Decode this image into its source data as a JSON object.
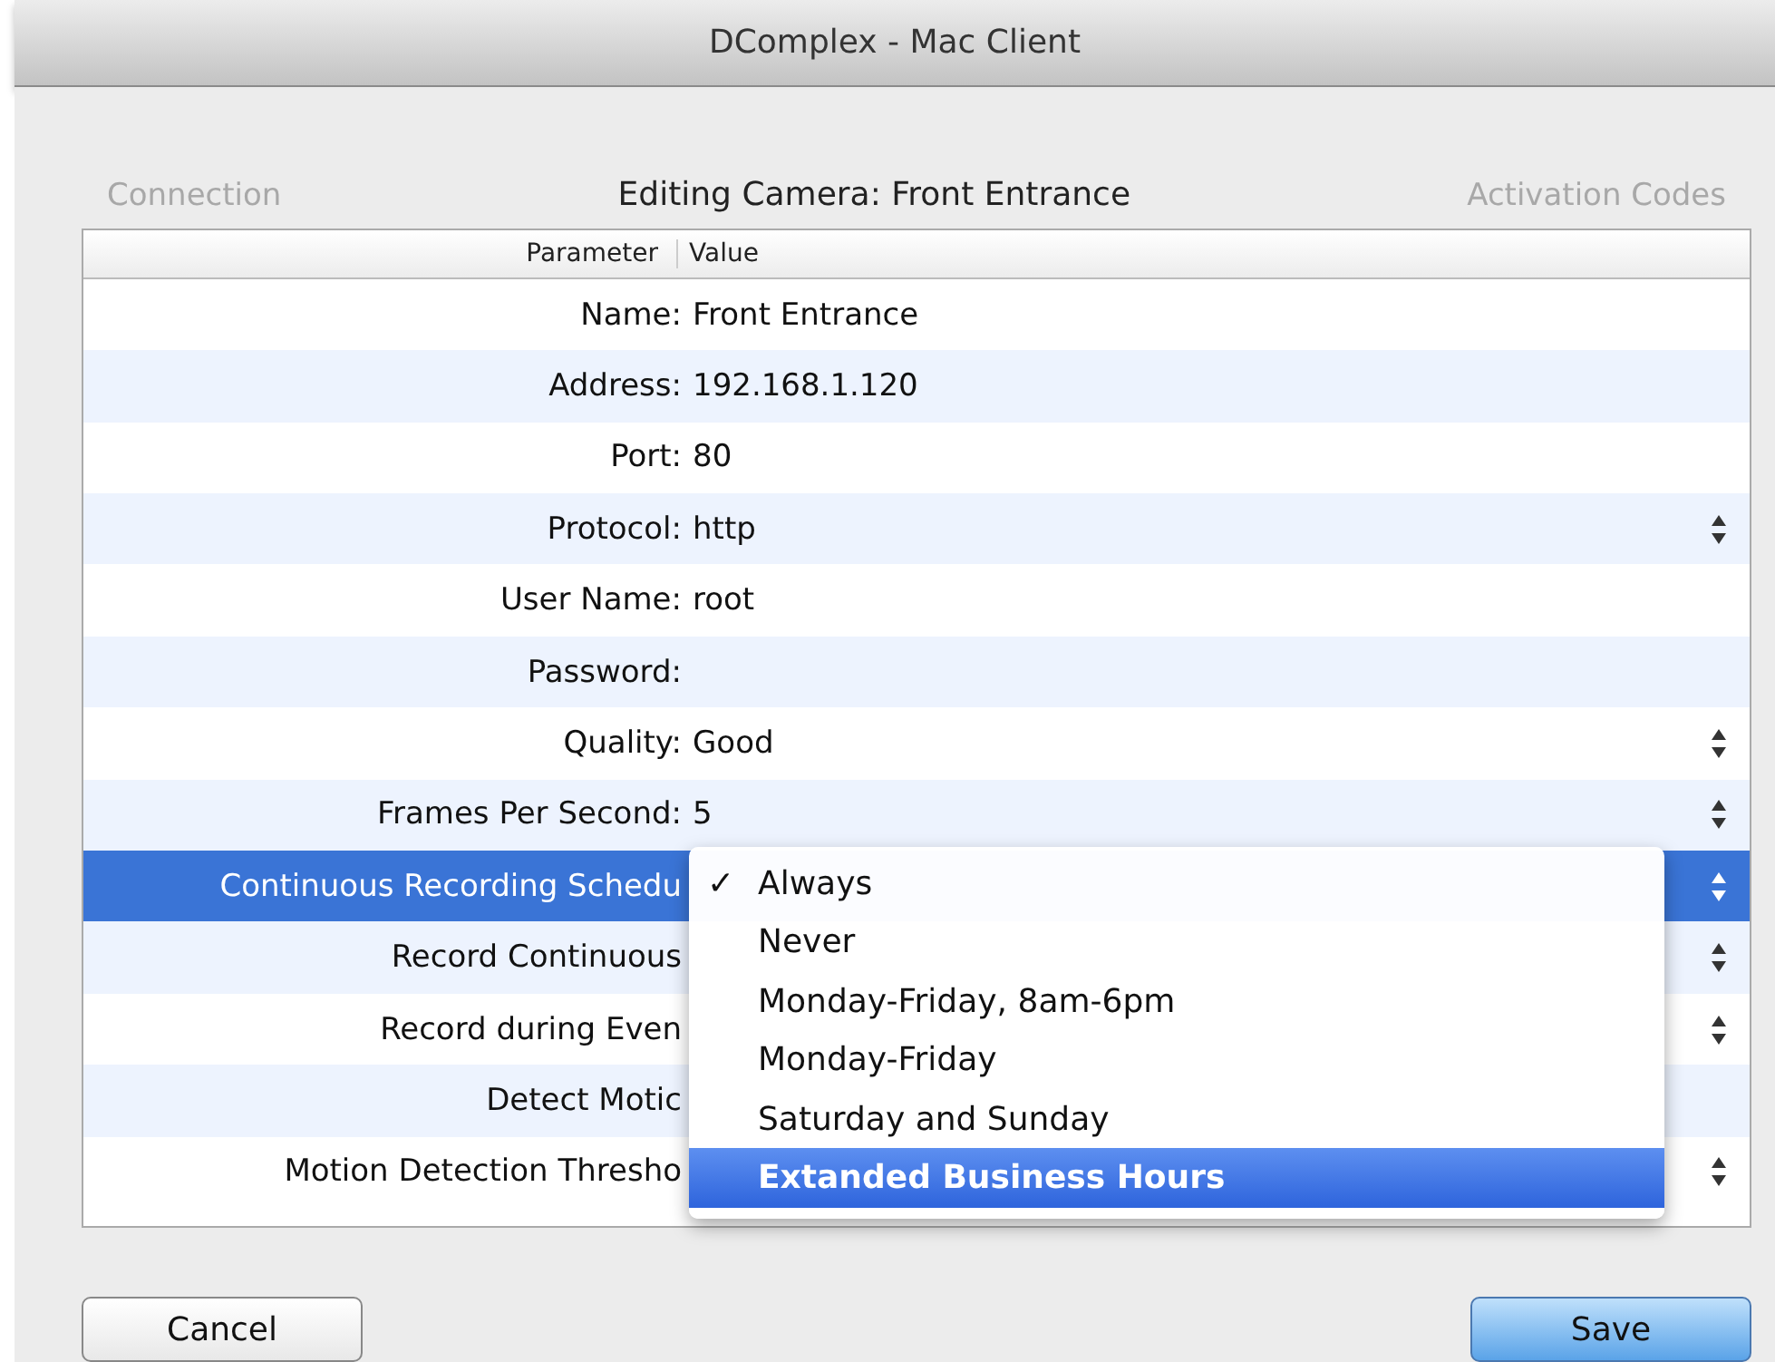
{
  "window": {
    "title": "DComplex - Mac Client"
  },
  "background_tabs": [
    {
      "label": "Connection"
    },
    {
      "label": "Activation Codes"
    }
  ],
  "sheet": {
    "title": "Editing Camera: Front Entrance"
  },
  "table": {
    "columns": [
      "Parameter",
      "Value"
    ],
    "rows": [
      {
        "kind": "text",
        "parameter": "Name:",
        "value": "Front Entrance",
        "selected": false
      },
      {
        "kind": "text",
        "parameter": "Address:",
        "value": "192.168.1.120",
        "selected": false
      },
      {
        "kind": "text",
        "parameter": "Port:",
        "value": "80",
        "selected": false
      },
      {
        "kind": "popup",
        "parameter": "Protocol:",
        "value": "http",
        "selected": false
      },
      {
        "kind": "text",
        "parameter": "User Name:",
        "value": "root",
        "selected": false
      },
      {
        "kind": "text",
        "parameter": "Password:",
        "selected": false
      },
      {
        "kind": "popup",
        "parameter": "Quality:",
        "value": "Good",
        "selected": false
      },
      {
        "kind": "popup",
        "parameter": "Frames Per Second:",
        "value": "5",
        "selected": false
      },
      {
        "kind": "popup",
        "parameter": "Continuous Recording Schedu",
        "selected": true
      },
      {
        "kind": "popup",
        "parameter": "Record Continuous",
        "selected": false
      },
      {
        "kind": "popup",
        "parameter": "Record during Even",
        "selected": false
      },
      {
        "kind": "text",
        "parameter": "Detect Motic",
        "selected": false
      },
      {
        "kind": "popup",
        "parameter": "Motion Detection Thresho",
        "selected": false
      }
    ]
  },
  "menu": {
    "check_glyph": "✓",
    "items": [
      {
        "label": "Always",
        "checked": true,
        "selected": false
      },
      {
        "label": "Never",
        "checked": false,
        "selected": false
      },
      {
        "label": "Monday-Friday, 8am-6pm",
        "checked": false,
        "selected": false
      },
      {
        "label": "Monday-Friday",
        "checked": false,
        "selected": false
      },
      {
        "label": "Saturday and Sunday",
        "checked": false,
        "selected": false
      },
      {
        "label": "Extanded Business Hours",
        "checked": false,
        "selected": true
      }
    ]
  },
  "buttons": [
    {
      "label": "Cancel",
      "default": false
    },
    {
      "label": "Save",
      "default": true
    }
  ]
}
